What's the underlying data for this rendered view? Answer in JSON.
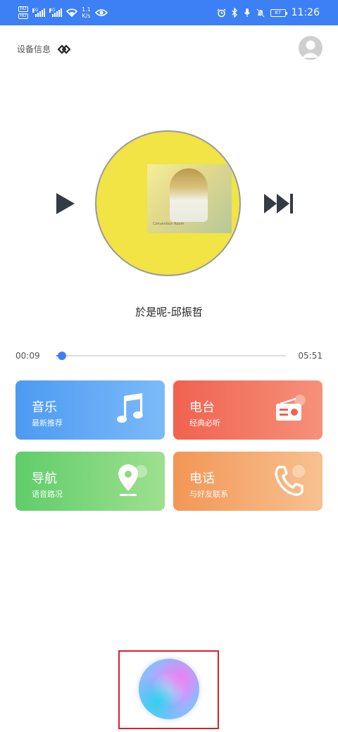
{
  "status_bar": {
    "sim1": "HD",
    "sim2": "HD",
    "signal1": "4G",
    "signal2": "4G",
    "net_speed_value": "1.1",
    "net_speed_unit": "K/s",
    "battery": "87",
    "time": "11:26"
  },
  "header": {
    "device_info_label": "设备信息",
    "link_icon": "link-icon",
    "avatar_icon": "user-avatar-icon"
  },
  "player": {
    "song_title": "於是呢-邱振哲",
    "current_time": "00:09",
    "total_time": "05:51",
    "progress": 0.026,
    "album_cover_text": "Convention Room"
  },
  "tiles": {
    "music": {
      "title": "音乐",
      "subtitle": "最新推荐",
      "icon": "music-note-icon"
    },
    "radio": {
      "title": "电台",
      "subtitle": "经典必听",
      "icon": "radio-icon"
    },
    "navigation": {
      "title": "导航",
      "subtitle": "语音路况",
      "icon": "location-pin-icon"
    },
    "phone": {
      "title": "电话",
      "subtitle": "与好友联系",
      "icon": "phone-icon"
    }
  },
  "colors": {
    "accent": "#3d7ff5",
    "music_tile": "#4c9af2",
    "radio_tile": "#f0624f",
    "nav_tile": "#5fcd6a",
    "phone_tile": "#f39656",
    "highlight_frame": "#d9202a"
  }
}
